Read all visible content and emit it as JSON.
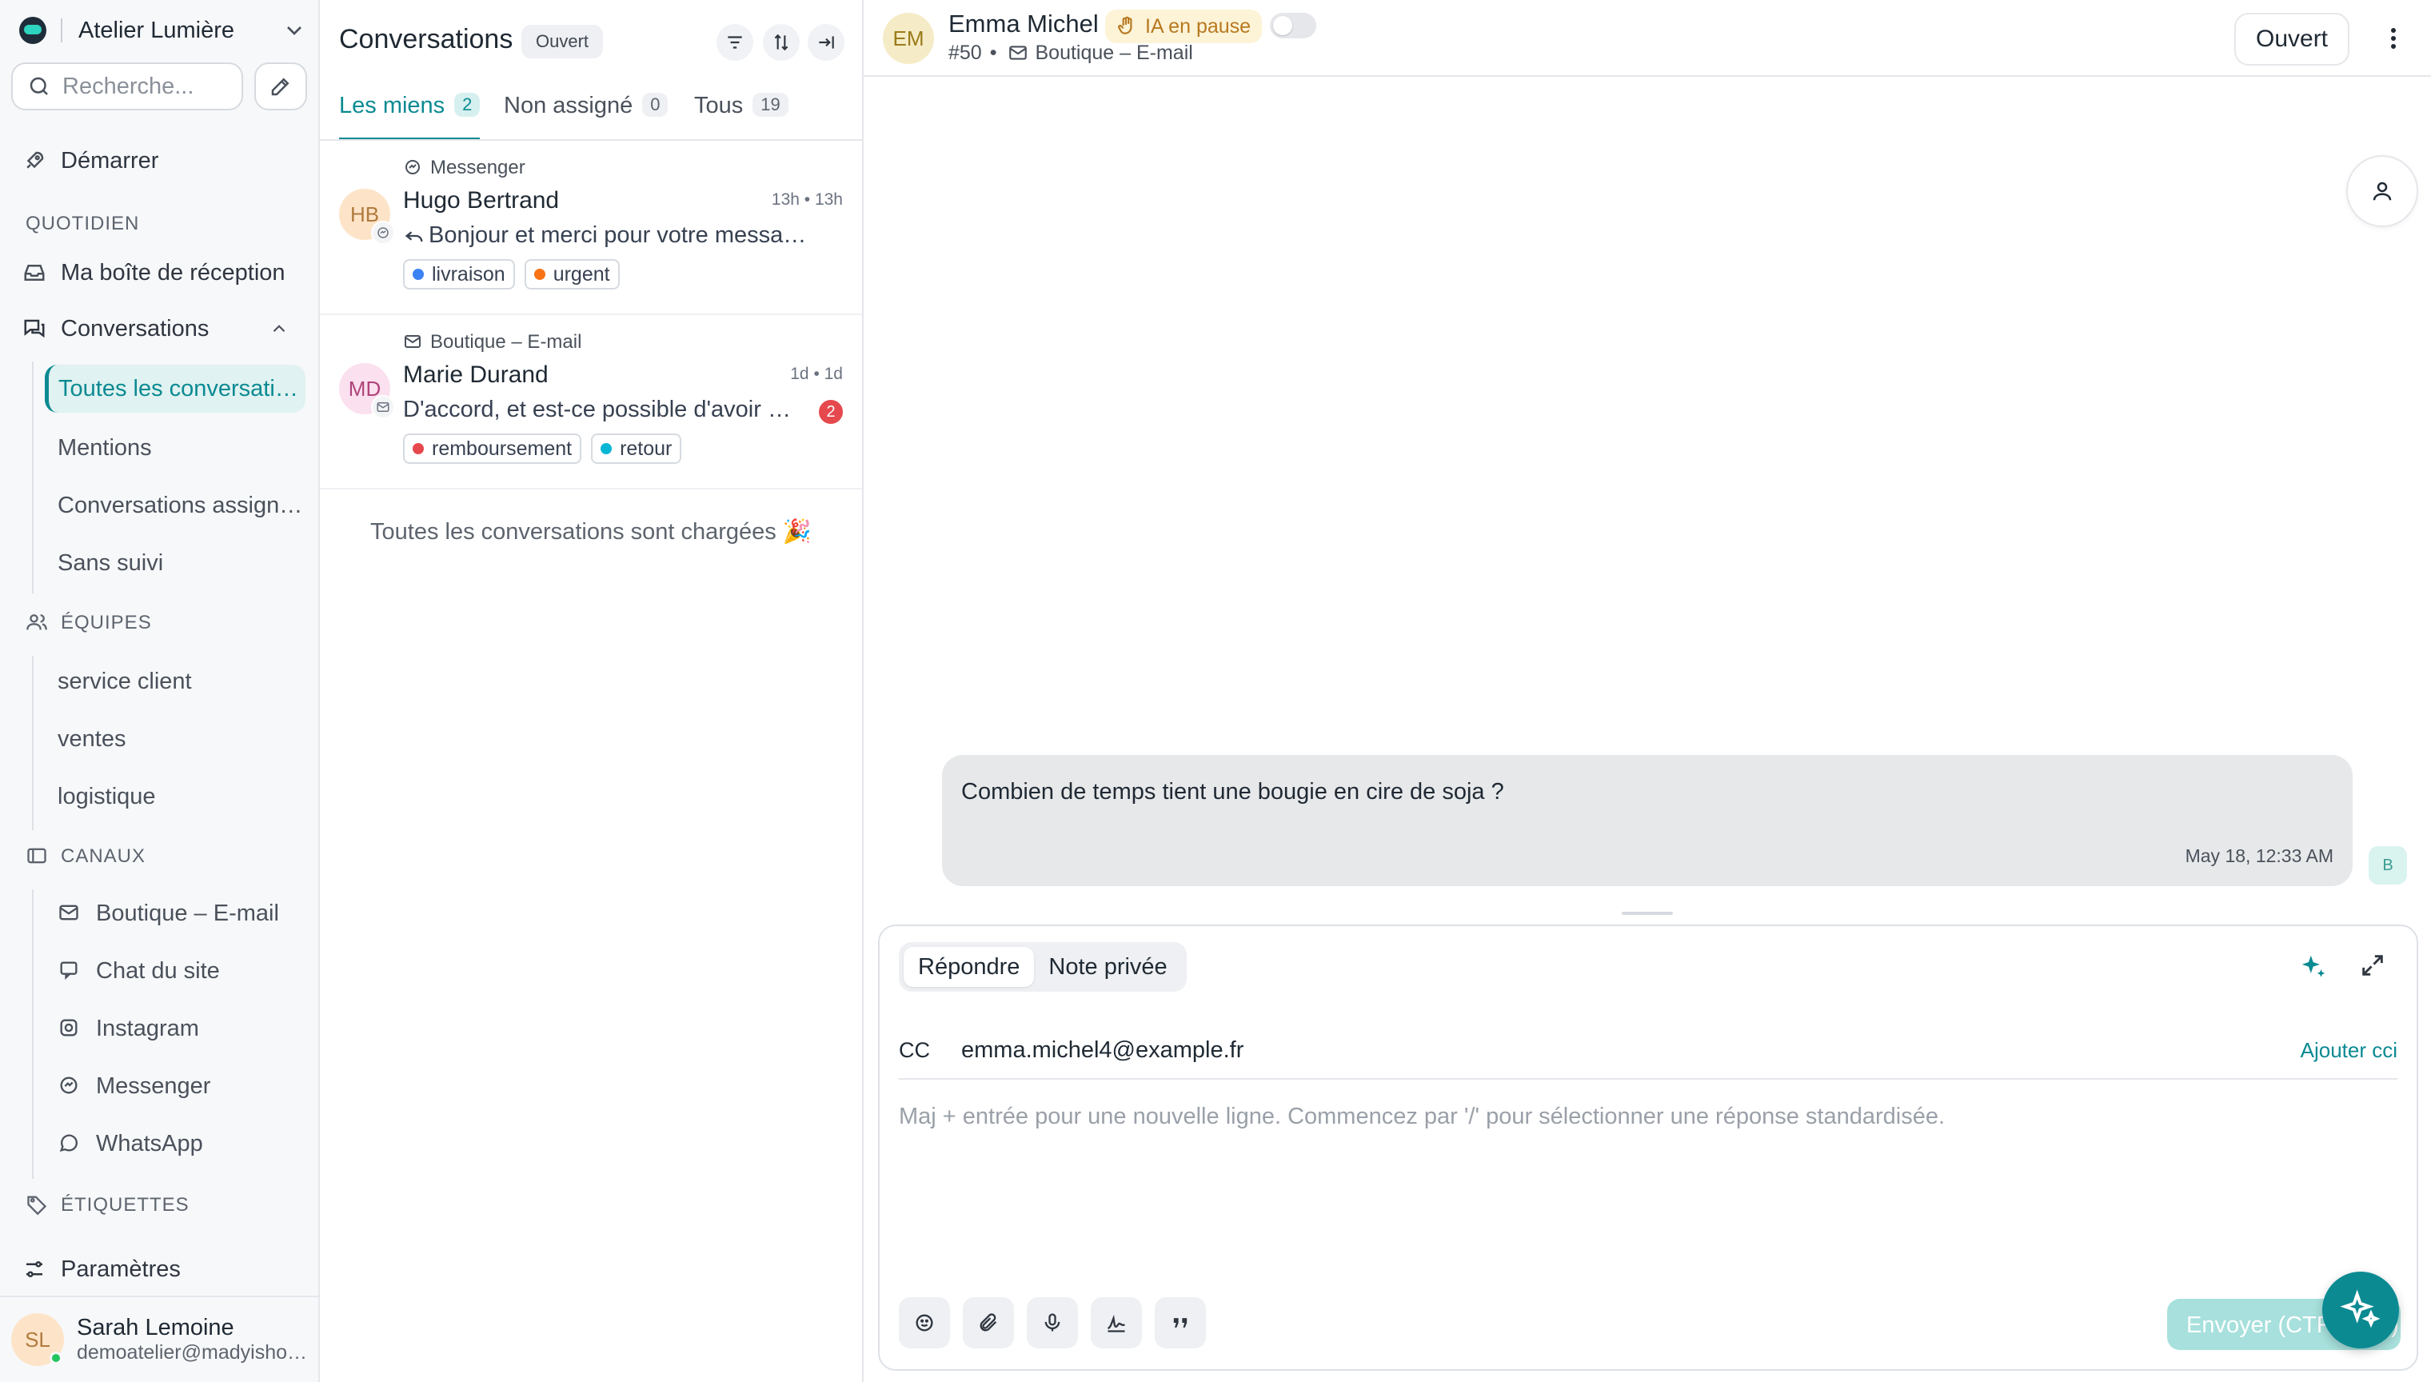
{
  "workspace": {
    "name": "Atelier Lumière"
  },
  "search": {
    "placeholder": "Recherche..."
  },
  "nav": {
    "start": "Démarrer",
    "daily_section": "QUOTIDIEN",
    "inbox": "Ma boîte de réception",
    "conversations": "Conversations",
    "conversation_items": [
      "Toutes les conversations",
      "Mentions",
      "Conversations assignées",
      "Sans suivi"
    ],
    "teams_section": "ÉQUIPES",
    "teams": [
      "service client",
      "ventes",
      "logistique"
    ],
    "channels_section": "CANAUX",
    "channels": [
      {
        "label": "Boutique – E-mail",
        "icon": "mail-icon"
      },
      {
        "label": "Chat du site",
        "icon": "chat-icon"
      },
      {
        "label": "Instagram",
        "icon": "instagram-icon"
      },
      {
        "label": "Messenger",
        "icon": "messenger-icon"
      },
      {
        "label": "WhatsApp",
        "icon": "whatsapp-icon"
      }
    ],
    "labels_section": "ÉTIQUETTES",
    "settings": "Paramètres"
  },
  "user": {
    "initials": "SL",
    "name": "Sarah Lemoine",
    "email": "demoatelier@madyishop.com"
  },
  "conv_list": {
    "title": "Conversations",
    "status": "Ouvert",
    "tabs": [
      {
        "label": "Les miens",
        "count": "2"
      },
      {
        "label": "Non assigné",
        "count": "0"
      },
      {
        "label": "Tous",
        "count": "19"
      }
    ],
    "items": [
      {
        "initials": "HB",
        "inbox": "Messenger",
        "name": "Hugo Bertrand",
        "time": "13h • 13h",
        "message": "Bonjour et merci pour votre message !",
        "labels": [
          {
            "name": "livraison",
            "color": "#3b82f6"
          },
          {
            "name": "urgent",
            "color": "#f97316"
          }
        ]
      },
      {
        "initials": "MD",
        "inbox": "Boutique – E-mail",
        "name": "Marie Durand",
        "time": "1d • 1d",
        "message": "D'accord, et est-ce possible d'avoir un échange ?",
        "unread": "2",
        "labels": [
          {
            "name": "remboursement",
            "color": "#e5484d"
          },
          {
            "name": "retour",
            "color": "#06b6d4"
          }
        ]
      }
    ],
    "all_loaded": "Toutes les conversations sont chargées 🎉"
  },
  "conversation": {
    "contact_initials": "EM",
    "contact_name": "Emma Michel",
    "ai_status": "IA en pause",
    "id": "#50",
    "inbox": "Boutique – E-mail",
    "status_button": "Ouvert",
    "messages": [
      {
        "text": "Combien de temps tient une bougie en cire de soja ?",
        "time": "May 18, 12:33 AM",
        "sender_initial": "B"
      }
    ]
  },
  "composer": {
    "mode_reply": "Répondre",
    "mode_note": "Note privée",
    "cc_label": "CC",
    "cc_value": "emma.michel4@example.fr",
    "add_bcc": "Ajouter cci",
    "placeholder": "Maj + entrée pour une nouvelle ligne. Commencez par '/' pour sélectionner une réponse standardisée.",
    "send_label": "Envoyer (CTRL + ↵)"
  },
  "colors": {
    "accent": "#0b8a92",
    "unread": "#e5484d",
    "ai_badge": "#b7791f"
  }
}
